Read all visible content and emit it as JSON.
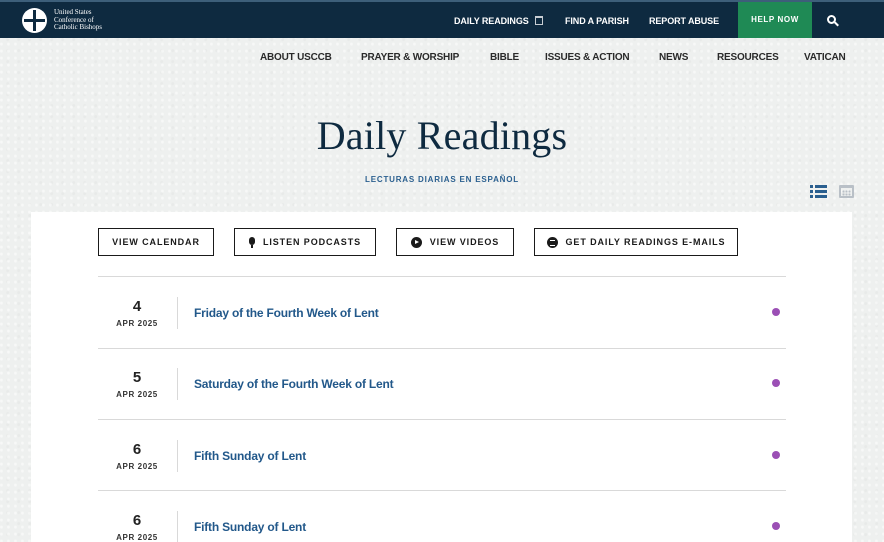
{
  "logo": {
    "text_line1": "United States",
    "text_line2": "Conference of",
    "text_line3": "Catholic Bishops"
  },
  "topbar": {
    "links": [
      {
        "label": "DAILY READINGS",
        "icon": "calendar-icon"
      },
      {
        "label": "FIND A PARISH"
      },
      {
        "label": "REPORT ABUSE"
      }
    ],
    "help_label": "HELP NOW",
    "search_icon": "search-icon",
    "background": "#0e2a40",
    "help_color": "#1f8a55"
  },
  "nav": {
    "items": [
      "ABOUT USCCB",
      "PRAYER & WORSHIP",
      "BIBLE",
      "ISSUES & ACTION",
      "NEWS",
      "RESOURCES",
      "VATICAN"
    ]
  },
  "page": {
    "title": "Daily Readings",
    "spanish_link": "LECTURAS DIARIAS EN ESPAÑOL",
    "view_toggles": [
      "list-view-icon",
      "calendar-view-icon"
    ]
  },
  "actions": [
    {
      "label": "VIEW CALENDAR",
      "icon": ""
    },
    {
      "label": "LISTEN PODCASTS",
      "icon": "microphone-icon"
    },
    {
      "label": "VIEW VIDEOS",
      "icon": "play-icon"
    },
    {
      "label": "GET DAILY READINGS E-MAILS",
      "icon": "mail-icon"
    }
  ],
  "readings": [
    {
      "day": "4",
      "month": "APR 2025",
      "title": "Friday of the Fourth Week of Lent",
      "color": "#9b4fb5"
    },
    {
      "day": "5",
      "month": "APR 2025",
      "title": "Saturday of the Fourth Week of Lent",
      "color": "#9b4fb5"
    },
    {
      "day": "6",
      "month": "APR 2025",
      "title": "Fifth Sunday of Lent",
      "color": "#9b4fb5"
    },
    {
      "day": "6",
      "month": "APR 2025",
      "title": "Fifth Sunday of Lent",
      "color": "#9b4fb5"
    }
  ]
}
